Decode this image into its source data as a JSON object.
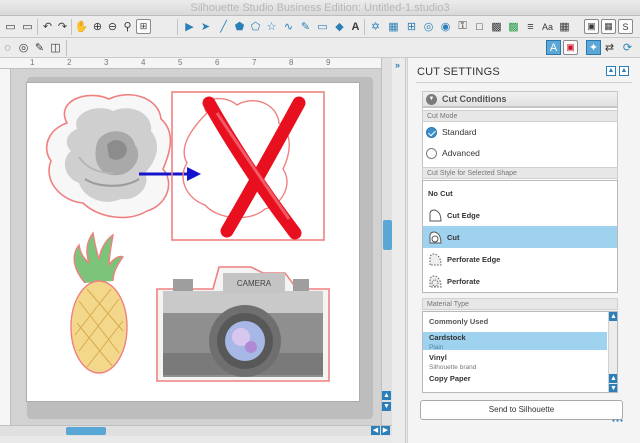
{
  "app": {
    "title": "Silhouette Studio Business Edition: Untitled-1.studio3"
  },
  "ruler": {
    "marks": [
      "1",
      "2",
      "3",
      "4",
      "5",
      "6",
      "7",
      "8",
      "9"
    ]
  },
  "panel": {
    "title": "CUT SETTINGS",
    "section_title": "Cut Conditions",
    "cut_mode_label": "Cut Mode",
    "modes": [
      "Standard",
      "Advanced"
    ],
    "selected_mode": "Standard",
    "cut_style_label": "Cut Style for Selected Shape",
    "cut_styles": [
      "No Cut",
      "Cut Edge",
      "Cut",
      "Perforate Edge",
      "Perforate"
    ],
    "selected_cut_style": "Cut",
    "material_type_label": "Material Type",
    "material_group": "Commonly Used",
    "materials": [
      {
        "name": "Cardstock",
        "detail": "Plain"
      },
      {
        "name": "Vinyl",
        "detail": "Silhouette brand"
      },
      {
        "name": "Copy Paper",
        "detail": ""
      }
    ],
    "selected_material": "Cardstock",
    "send_label": "Send to Silhouette"
  },
  "camera": {
    "brand": "CAMERA"
  },
  "colors": {
    "accent": "#2c7fb8",
    "selection": "#9fd2ee",
    "outline": "#f08080",
    "cross": "#e8101f",
    "arrow": "#1414cc"
  },
  "icons": [
    "undo-icon",
    "redo-icon",
    "pan-icon",
    "zoom-in-icon",
    "zoom-out-icon",
    "zoom-select-icon",
    "fit-page-icon",
    "text-icon",
    "send-icon"
  ]
}
